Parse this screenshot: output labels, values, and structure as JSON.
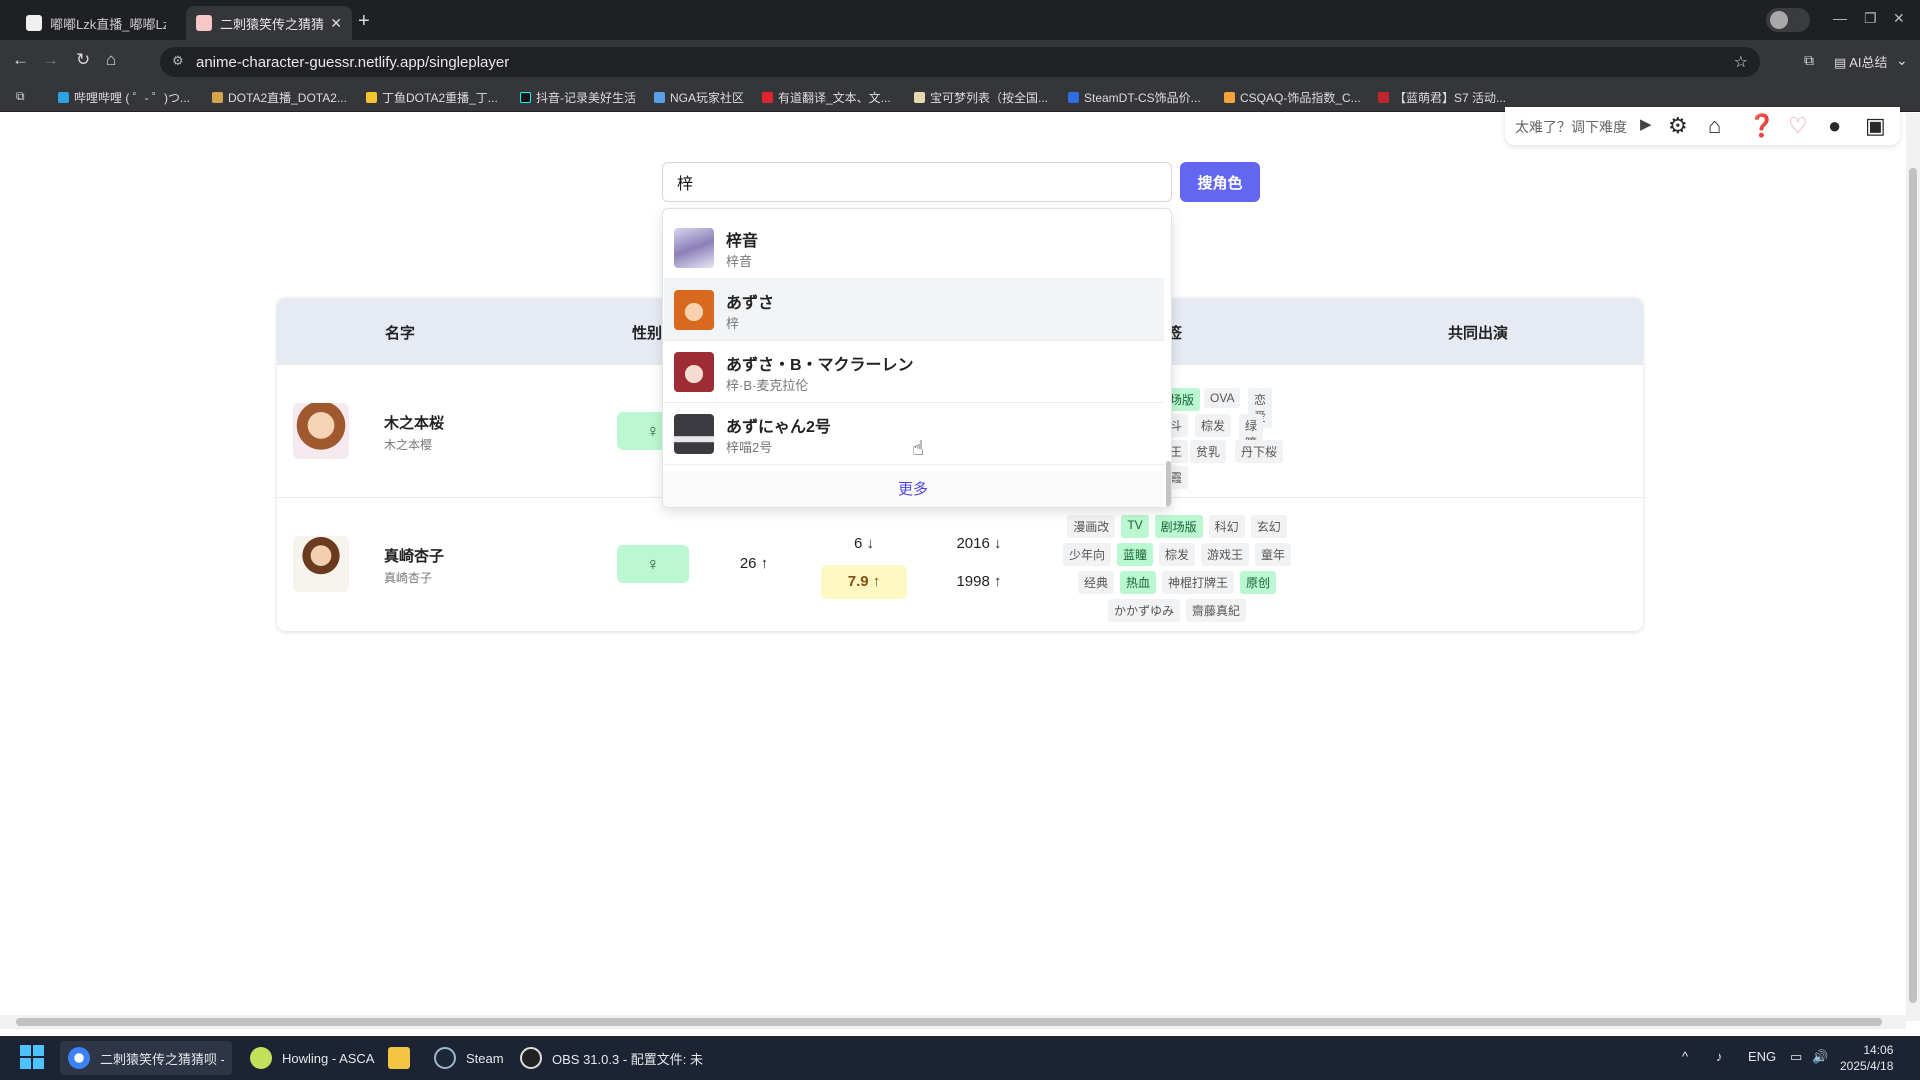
{
  "browser": {
    "tabs": [
      {
        "title": "嘟嘟Lzk直播_嘟嘟Lzk"
      },
      {
        "title": "二刺猿笑传之猜猜呗"
      }
    ],
    "url": "anime-character-guessr.netlify.app/singleplayer",
    "extensions_label": "AI总结",
    "bookmarks": [
      "哔哩哔哩 ( ゜- ゜)つ...",
      "DOTA2直播_DOTA2...",
      "丁鱼DOTA2重播_丁...",
      "抖音-记录美好生活",
      "NGA玩家社区",
      "有道翻译_文本、文...",
      "宝可梦列表（按全国...",
      "SteamDT-CS饰品价...",
      "CSQAQ-饰品指数_C...",
      "【蓝萌君】S7 活动..."
    ]
  },
  "toolbar": {
    "hint": "太难了？调下难度"
  },
  "search": {
    "value": "梓",
    "button_label": "搜角色"
  },
  "dropdown": {
    "items": [
      {
        "name": "梓音",
        "sub": "梓音"
      },
      {
        "name": "あずさ",
        "sub": "梓"
      },
      {
        "name": "あずさ・B・マクラーレン",
        "sub": "梓·B·麦克拉伦"
      },
      {
        "name": "あずにゃん2号",
        "sub": "梓喵2号"
      }
    ],
    "more_label": "更多"
  },
  "table": {
    "headers": {
      "name": "名字",
      "gender": "性别",
      "tags": "签",
      "shared": "共同出演"
    },
    "rows": [
      {
        "name": "木之本桜",
        "sub": "木之本樱",
        "gender": "♀",
        "visible_tags": [
          "场版",
          "OVA",
          "恋爱",
          "斗",
          "棕发",
          "绿瞳",
          "王",
          "贫乳",
          "丹下桜",
          "霞"
        ]
      },
      {
        "name": "真崎杏子",
        "sub": "真崎杏子",
        "gender": "♀",
        "age": "26 ↑",
        "count": "6 ↓",
        "score": "7.9 ↑",
        "year_top": "2016 ↓",
        "year_bottom": "1998 ↑",
        "tags": [
          "漫画改",
          "TV",
          "剧场版",
          "科幻",
          "玄幻",
          "少年向",
          "蓝瞳",
          "棕发",
          "游戏王",
          "童年",
          "经典",
          "热血",
          "神棍打牌王",
          "原创",
          "かかずゆみ",
          "齋藤真紀"
        ],
        "highlighted_tags": [
          "TV",
          "剧场版",
          "蓝瞳",
          "热血",
          "原创"
        ]
      }
    ]
  },
  "taskbar": {
    "apps": [
      "二刺猿笑传之猜猜呗 - 哥",
      "Howling - ASCA",
      "Steam",
      "OBS 31.0.3 - 配置文件: 未"
    ],
    "lang": "ENG",
    "time": "14:06",
    "date": "2025/4/18"
  },
  "colors": {
    "accent": "#6366f1",
    "match": "#bbf7d0",
    "partial": "#fef9c3"
  }
}
